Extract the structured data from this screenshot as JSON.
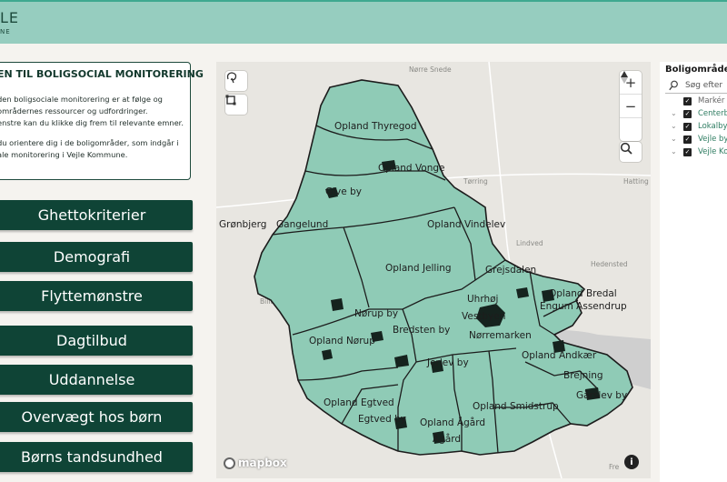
{
  "header": {
    "logo_mark": "LE",
    "logo_sub": "NE",
    "bg_color": "#96cdbf"
  },
  "intro": {
    "title": "EN TIL BOLIGSOCIAL MONITORERING",
    "p1": "den boligsociale monitorering er at følge og\nområdernes ressourcer og udfordringer.\nenstre kan du klikke dig frem til relevante emner.",
    "p2": "du orientere dig i de boligområder, som indgår i\nale monitorering i Vejle Kommune."
  },
  "nav": {
    "items": [
      {
        "label": "Ghettokriterier"
      },
      {
        "label": "Demografi"
      },
      {
        "label": "Flyttemønstre"
      },
      {
        "label": "Dagtilbud"
      },
      {
        "label": "Uddannelse"
      },
      {
        "label": "Overvægt hos børn"
      },
      {
        "label": "Børns tandsundhed"
      }
    ],
    "color": "#0f4436"
  },
  "map": {
    "fill_color": "#8fcbb6",
    "basemap_places": [
      "Nørre Snede",
      "Tørring",
      "Hatting",
      "Lindved",
      "Billund",
      "Hedensted",
      "Fre"
    ],
    "areas": [
      "Opland Thyregod",
      "Opland Vonge",
      "Give by",
      "Grønbjerg",
      "Gangelund",
      "Opland Vindelev",
      "Opland Jelling",
      "Grejsdalen",
      "Opland Bredal",
      "Engum Assendrup",
      "Uhrhøj",
      "Nørup by",
      "Bredsten by",
      "Vestbyen",
      "Nørremarken",
      "Opland Nørup",
      "Jerlev by",
      "Opland Andkær",
      "Brejning",
      "Opland Egtved",
      "Egtved by",
      "Opland Smidstrup",
      "Opland Ågård",
      "Ågård",
      "Gårslev by"
    ],
    "controls": {
      "zoom_in": "+",
      "zoom_out": "−",
      "compass": "▲",
      "info": "i"
    },
    "attribution": "mapbox"
  },
  "legend": {
    "title": "Boligområde",
    "search_placeholder": "Søg efter",
    "items": [
      {
        "label": "Markér",
        "color": "#666666",
        "chevron": false
      },
      {
        "label": "Centerb",
        "color": "#2f7d62",
        "chevron": true
      },
      {
        "label": "Lokalby",
        "color": "#2f7d62",
        "chevron": true
      },
      {
        "label": "Vejle by",
        "color": "#2f7d62",
        "chevron": true
      },
      {
        "label": "Vejle Ko",
        "color": "#2f7d62",
        "chevron": true
      }
    ]
  }
}
